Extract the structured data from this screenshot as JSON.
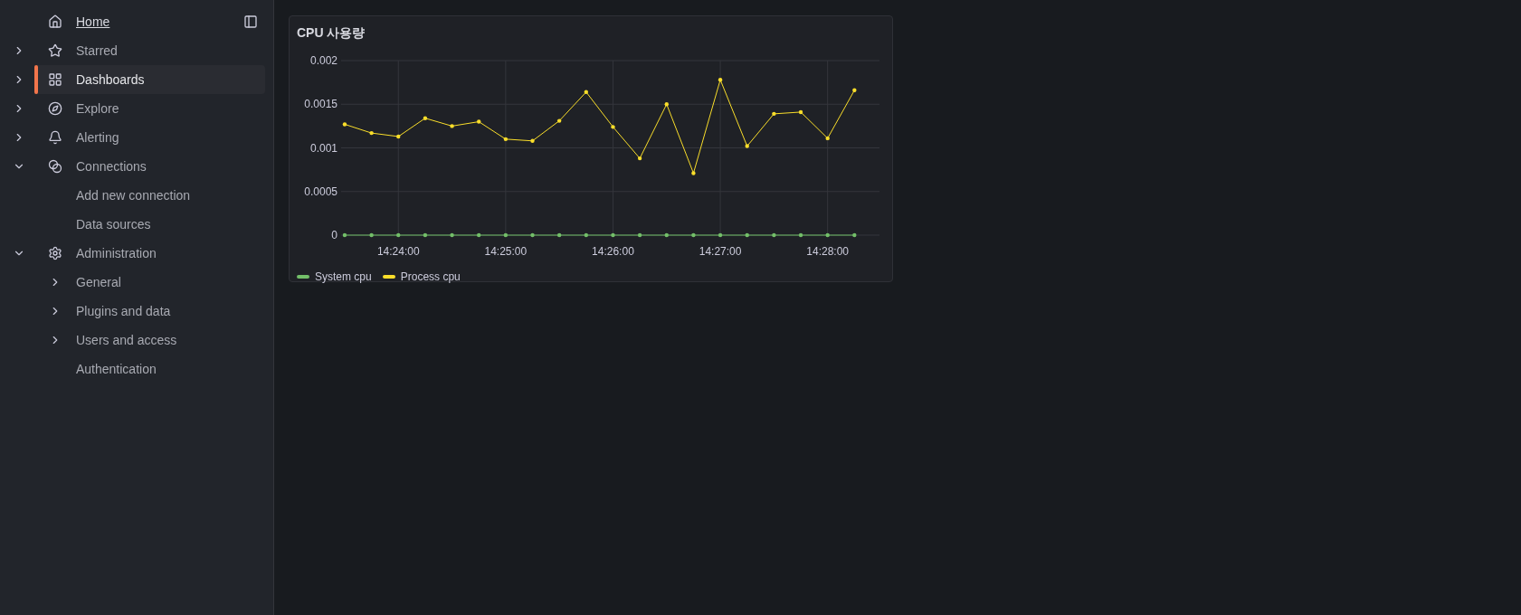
{
  "sidebar": {
    "items": [
      {
        "label": "Home",
        "kind": "home",
        "selected": false
      },
      {
        "label": "Starred",
        "kind": "section",
        "selected": false,
        "expanded": false
      },
      {
        "label": "Dashboards",
        "kind": "section",
        "selected": true,
        "expanded": false
      },
      {
        "label": "Explore",
        "kind": "section",
        "selected": false,
        "expanded": false
      },
      {
        "label": "Alerting",
        "kind": "section",
        "selected": false,
        "expanded": false
      },
      {
        "label": "Connections",
        "kind": "section",
        "selected": false,
        "expanded": true,
        "children": [
          {
            "label": "Add new connection",
            "selected": false
          },
          {
            "label": "Data sources",
            "selected": false
          }
        ]
      },
      {
        "label": "Administration",
        "kind": "section",
        "selected": false,
        "expanded": true,
        "children": [
          {
            "label": "General",
            "selected": false,
            "expanded": false
          },
          {
            "label": "Plugins and data",
            "selected": false,
            "expanded": false
          },
          {
            "label": "Users and access",
            "selected": false,
            "expanded": false
          },
          {
            "label": "Authentication",
            "selected": false
          }
        ]
      }
    ]
  },
  "panel": {
    "title": "CPU 사용량",
    "chart_data": {
      "type": "line",
      "x": [
        51810,
        51825,
        51840,
        51855,
        51870,
        51885,
        51900,
        51915,
        51930,
        51945,
        51960,
        51975,
        51990,
        52005,
        52020,
        52035,
        52050,
        52065,
        52080,
        52095
      ],
      "xlim": [
        51808,
        52109
      ],
      "grid": true,
      "legend": true,
      "series": [
        {
          "name": "System cpu",
          "color": "#73bf69",
          "values": [
            0,
            0,
            0,
            0,
            0,
            0,
            0,
            0,
            0,
            0,
            0,
            0,
            0,
            0,
            0,
            0,
            0,
            0,
            0,
            0
          ]
        },
        {
          "name": "Process cpu",
          "color": "#fade2a",
          "values": [
            0.00127,
            0.00117,
            0.00113,
            0.00134,
            0.00125,
            0.0013,
            0.0011,
            0.00108,
            0.00131,
            0.00164,
            0.00124,
            0.00088,
            0.0015,
            0.00071,
            0.00178,
            0.00102,
            0.00139,
            0.00141,
            0.00111,
            0.00166
          ]
        }
      ],
      "ylim": [
        0,
        0.002
      ],
      "yticks": [
        {
          "value": 0,
          "label": "0"
        },
        {
          "value": 0.0005,
          "label": "0.0005"
        },
        {
          "value": 0.001,
          "label": "0.001"
        },
        {
          "value": 0.0015,
          "label": "0.0015"
        },
        {
          "value": 0.002,
          "label": "0.002"
        }
      ],
      "xticks": [
        {
          "value": 51840,
          "label": "14:24:00"
        },
        {
          "value": 51900,
          "label": "14:25:00"
        },
        {
          "value": 51960,
          "label": "14:26:00"
        },
        {
          "value": 52020,
          "label": "14:27:00"
        },
        {
          "value": 52080,
          "label": "14:28:00"
        }
      ]
    }
  }
}
